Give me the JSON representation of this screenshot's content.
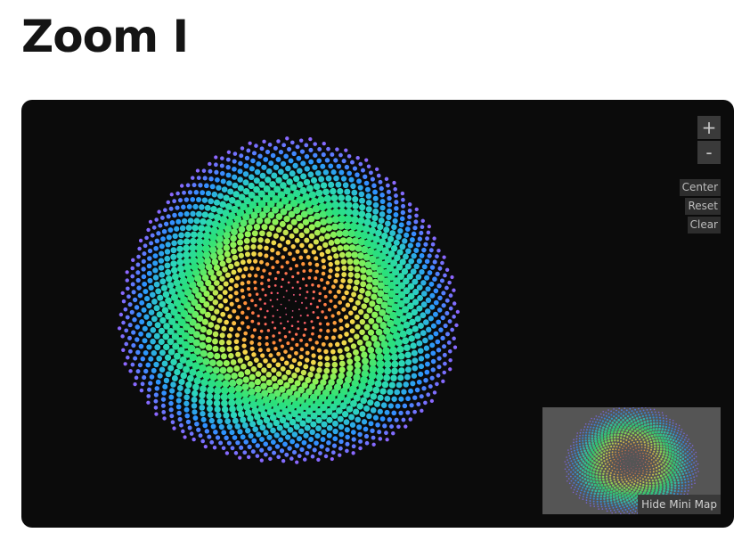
{
  "page": {
    "title": "Zoom I"
  },
  "controls": {
    "zoom_in_label": "+",
    "zoom_out_label": "-",
    "center_label": "Center",
    "reset_label": "Reset",
    "clear_label": "Clear"
  },
  "minimap": {
    "toggle_label": "Hide Mini Map"
  },
  "colors": {
    "viewport_background": "#0b0b0b",
    "minimap_background": "#555555",
    "button_background": "#3a3a3a",
    "spiral_palette": [
      "#d25a9a",
      "#ff5c6d",
      "#ff8a38",
      "#f6d84a",
      "#8ff255",
      "#2ae07a",
      "#2bd5bd",
      "#2d92ff",
      "#8f66ff"
    ]
  },
  "icons": {
    "zoom_in": "plus-icon",
    "zoom_out": "minus-icon"
  }
}
